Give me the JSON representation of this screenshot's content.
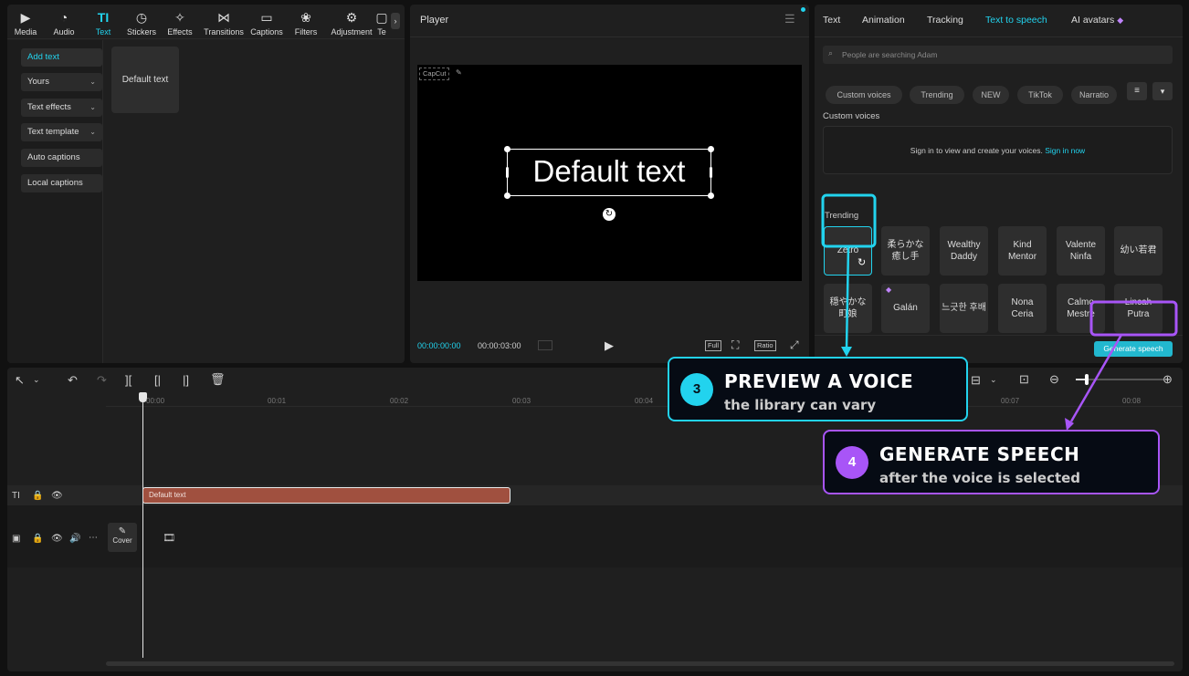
{
  "toolbar": {
    "items": [
      {
        "label": "Media",
        "icon": "media-icon"
      },
      {
        "label": "Audio",
        "icon": "audio-icon"
      },
      {
        "label": "Text",
        "icon": "text-icon"
      },
      {
        "label": "Stickers",
        "icon": "stickers-icon"
      },
      {
        "label": "Effects",
        "icon": "effects-icon"
      },
      {
        "label": "Transitions",
        "icon": "transitions-icon"
      },
      {
        "label": "Captions",
        "icon": "captions-icon"
      },
      {
        "label": "Filters",
        "icon": "filters-icon"
      },
      {
        "label": "Adjustment",
        "icon": "adjustment-icon"
      },
      {
        "label": "Te",
        "icon": "template-icon"
      }
    ]
  },
  "sidebar": {
    "items": [
      {
        "label": "Add text"
      },
      {
        "label": "Yours"
      },
      {
        "label": "Text effects"
      },
      {
        "label": "Text template"
      },
      {
        "label": "Auto captions"
      },
      {
        "label": "Local captions"
      }
    ],
    "default_card": "Default text"
  },
  "player": {
    "title": "Player",
    "watermark": "CapCut",
    "overlay_text": "Default text",
    "current_time": "00:00:00:00",
    "total_time": "00:00:03:00",
    "btn_full": "Full",
    "btn_ratio": "Ratio"
  },
  "right_panel": {
    "tabs": [
      {
        "label": "Text"
      },
      {
        "label": "Animation"
      },
      {
        "label": "Tracking"
      },
      {
        "label": "Text to speech"
      },
      {
        "label": "AI avatars"
      }
    ],
    "active_tab": "Text to speech",
    "search_placeholder": "People are searching Adam",
    "filters": [
      "Custom voices",
      "Trending",
      "NEW",
      "TikTok",
      "Narratio"
    ],
    "custom_voices_title": "Custom voices",
    "signin_text": "Sign in to view and create your voices.",
    "signin_link": "Sign in now",
    "trending_title": "Trending",
    "voices_row1": [
      "Zetro",
      "柔らかな癒し手",
      "Wealthy Daddy",
      "Kind Mentor",
      "Valente Ninfa",
      "幼い若君"
    ],
    "voices_row2": [
      "穏やかな町娘",
      "Galán",
      "느긋한 후배",
      "Nona Ceria",
      "Calmo Mestre",
      "Lincah Putra"
    ],
    "generate_label": "Generate speech",
    "accent": "#22d3ee"
  },
  "timeline": {
    "ticks": [
      "00:00",
      "00:01",
      "00:02",
      "00:03",
      "00:04",
      "00:07",
      "00:08"
    ],
    "clip_label": "Default text",
    "cover_label": "Cover"
  },
  "annotations": [
    {
      "number": "3",
      "title": "PREVIEW A VOICE",
      "subtitle": "the library can vary",
      "color": "#22d3ee"
    },
    {
      "number": "4",
      "title": "GENERATE SPEECH",
      "subtitle": "after the voice is selected",
      "color": "#a855f7"
    }
  ]
}
